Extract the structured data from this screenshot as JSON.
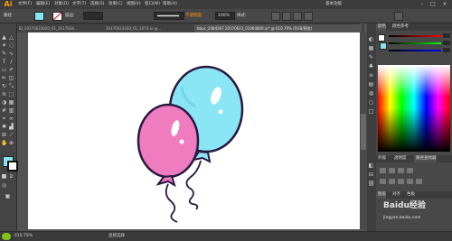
{
  "app": {
    "logo": "Ai",
    "workspace": "基本功能"
  },
  "menus": [
    "文件(F)",
    "编辑(E)",
    "对象(O)",
    "文字(T)",
    "选择(S)",
    "效果(C)",
    "视图(V)",
    "窗口(W)",
    "帮助(H)"
  ],
  "control_bar": {
    "mode_label": "路径",
    "stroke_label": "描边:",
    "uniform_label": "等比",
    "style_label": "基本",
    "opacity_label": "不透明度:",
    "opacity_value": "100%",
    "style_dropdown": "样式:"
  },
  "tabs": [
    {
      "label": "IB_20170623020_01_2017B36..."
    },
    {
      "label": "20170623160_01_1070.ai @..."
    },
    {
      "label": "bbpc_2484267 20170623_01064806.ai* @ 610.79% (RGB/预览)"
    }
  ],
  "right_panels": {
    "color_tab": "颜色",
    "swatches_tab": "色板",
    "layers_tab": "图层",
    "align_tab": "对齐",
    "color_guide": "颜色参考",
    "pathfinder": "路径查找器",
    "appearance": "外观",
    "transparency": "透明度"
  },
  "status": {
    "zoom": "610.79%",
    "tool": "直接选择",
    "watermark": "Baidu经验",
    "watermark_url": "jingyan.baidu.com"
  },
  "colors": {
    "balloon_pink": "#f07cc0",
    "balloon_blue": "#8ae6f4",
    "outline": "#2a1740",
    "accent": "#ff9a00"
  }
}
